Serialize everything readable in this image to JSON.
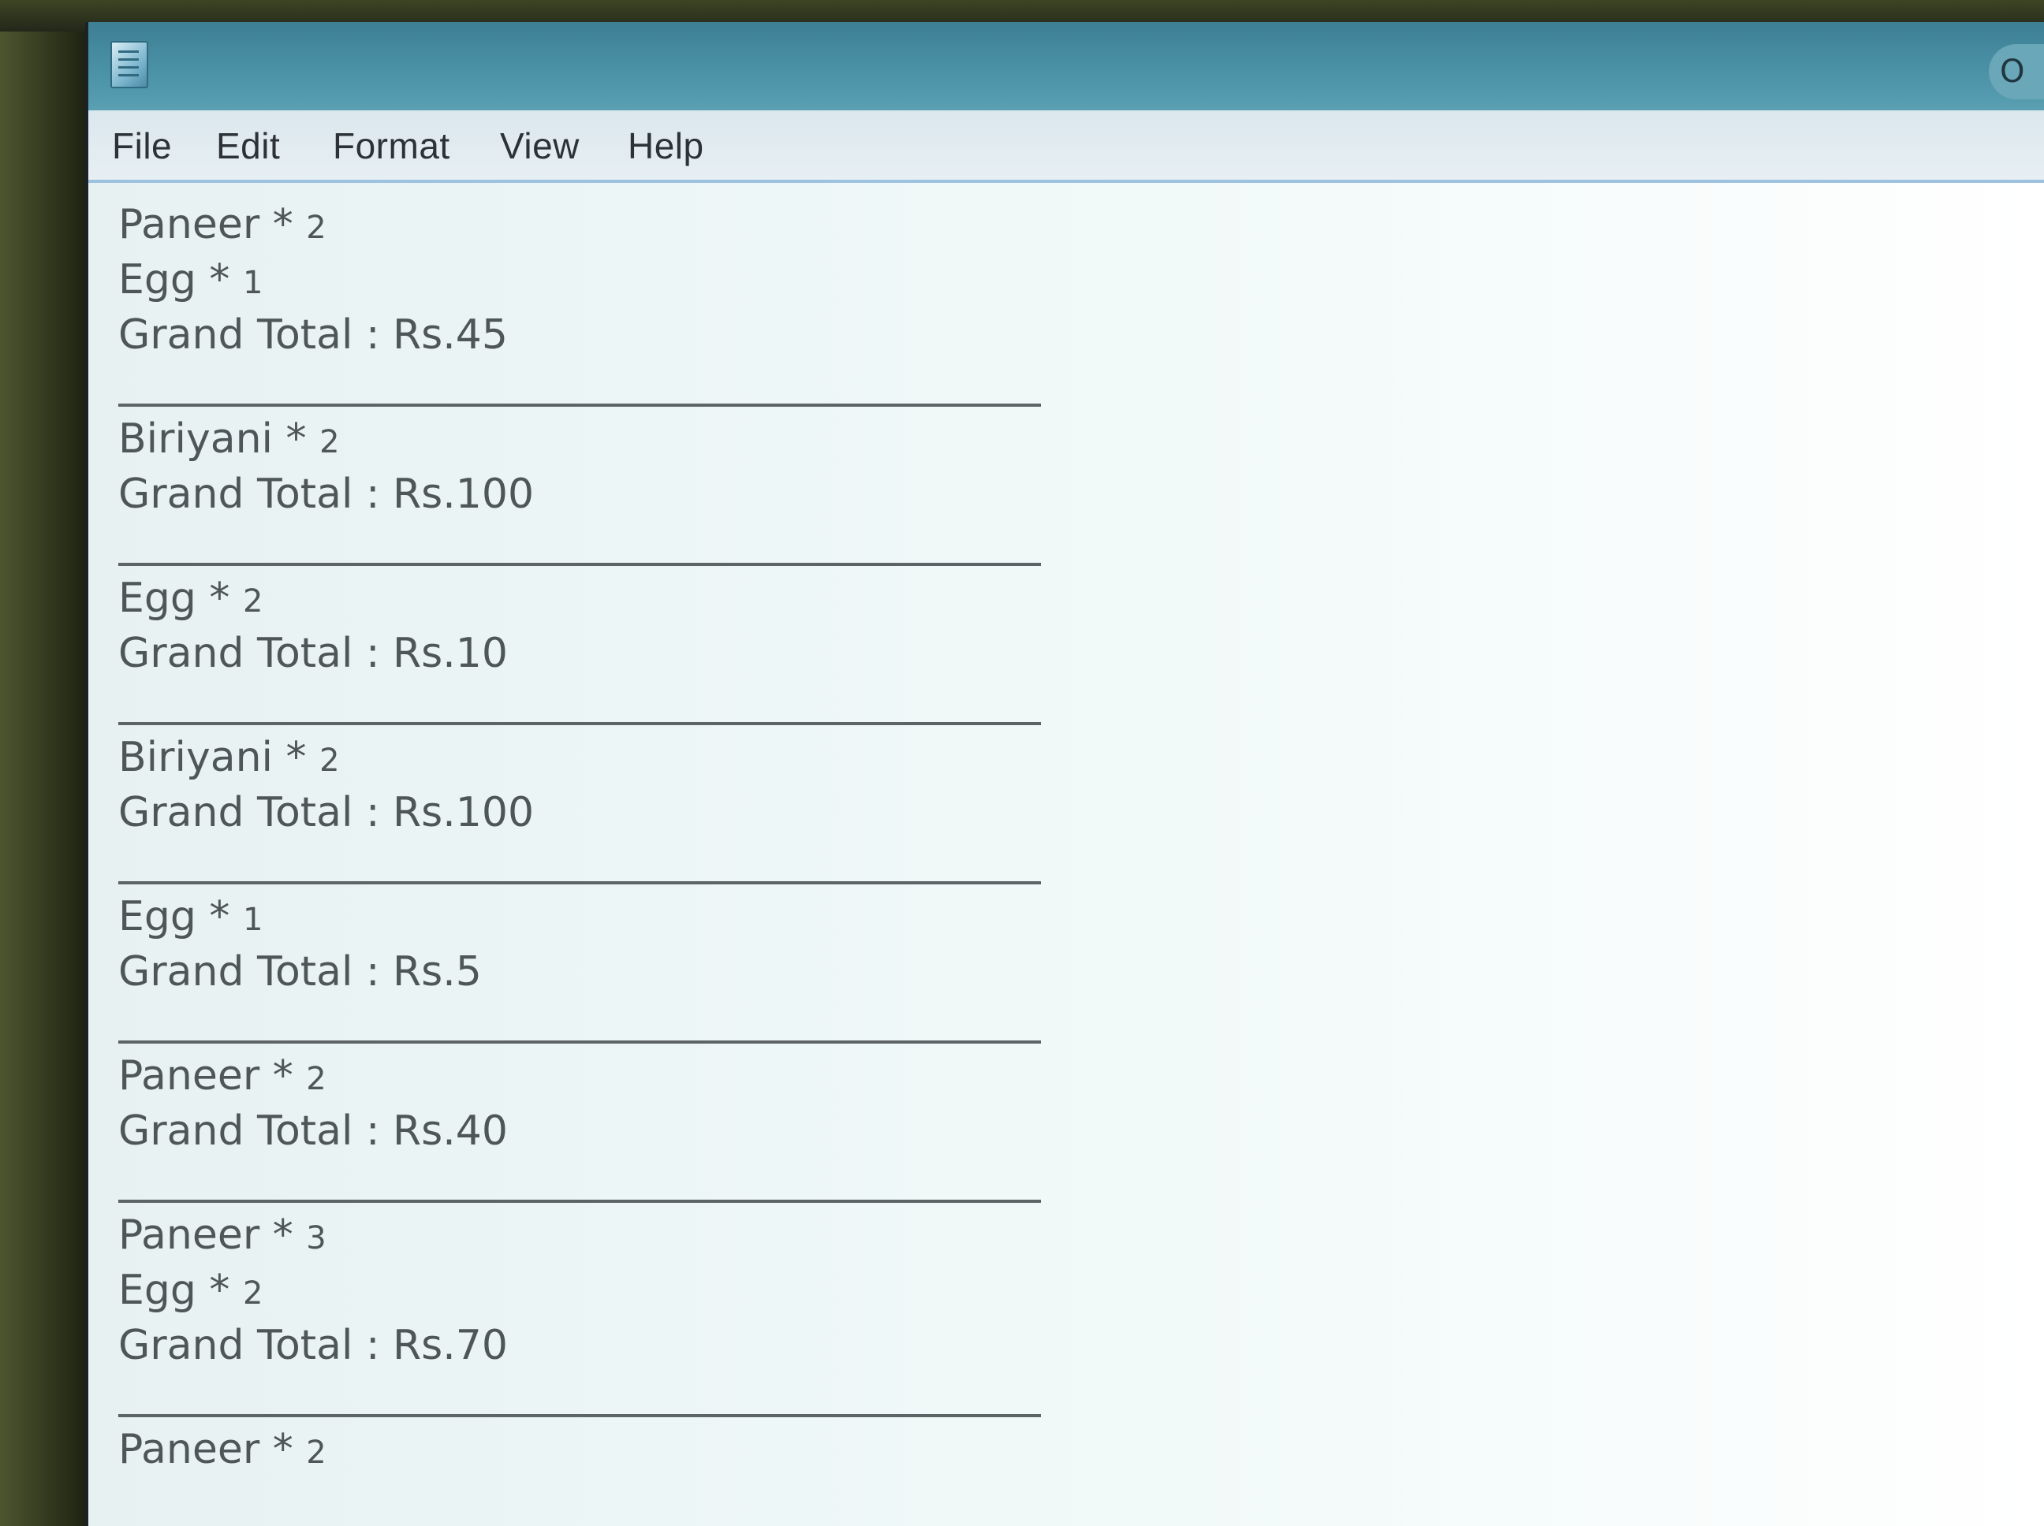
{
  "menu": {
    "file": "File",
    "edit": "Edit",
    "format": "Format",
    "view": "View",
    "help": "Help"
  },
  "window": {
    "title": "",
    "minimize_glyph": "O"
  },
  "entries": [
    {
      "lines": [
        {
          "item": "Paneer",
          "qty": "2"
        },
        {
          "item": "Egg",
          "qty": "1"
        },
        {
          "total": "Grand Total : Rs.45"
        }
      ]
    },
    {
      "lines": [
        {
          "item": "Biriyani",
          "qty": "2"
        },
        {
          "total": "Grand Total : Rs.100"
        }
      ]
    },
    {
      "lines": [
        {
          "item": "Egg",
          "qty": "2"
        },
        {
          "total": "Grand Total : Rs.10"
        }
      ]
    },
    {
      "lines": [
        {
          "item": "Biriyani",
          "qty": "2"
        },
        {
          "total": "Grand Total : Rs.100"
        }
      ]
    },
    {
      "lines": [
        {
          "item": "Egg",
          "qty": "1"
        },
        {
          "total": "Grand Total : Rs.5"
        }
      ]
    },
    {
      "lines": [
        {
          "item": "Paneer",
          "qty": "2"
        },
        {
          "total": "Grand Total : Rs.40"
        }
      ]
    },
    {
      "lines": [
        {
          "item": "Paneer",
          "qty": "3"
        },
        {
          "item": "Egg",
          "qty": "2"
        },
        {
          "total": "Grand Total : Rs.70"
        }
      ]
    },
    {
      "lines": [
        {
          "item": "Paneer",
          "qty": "2"
        }
      ]
    }
  ]
}
